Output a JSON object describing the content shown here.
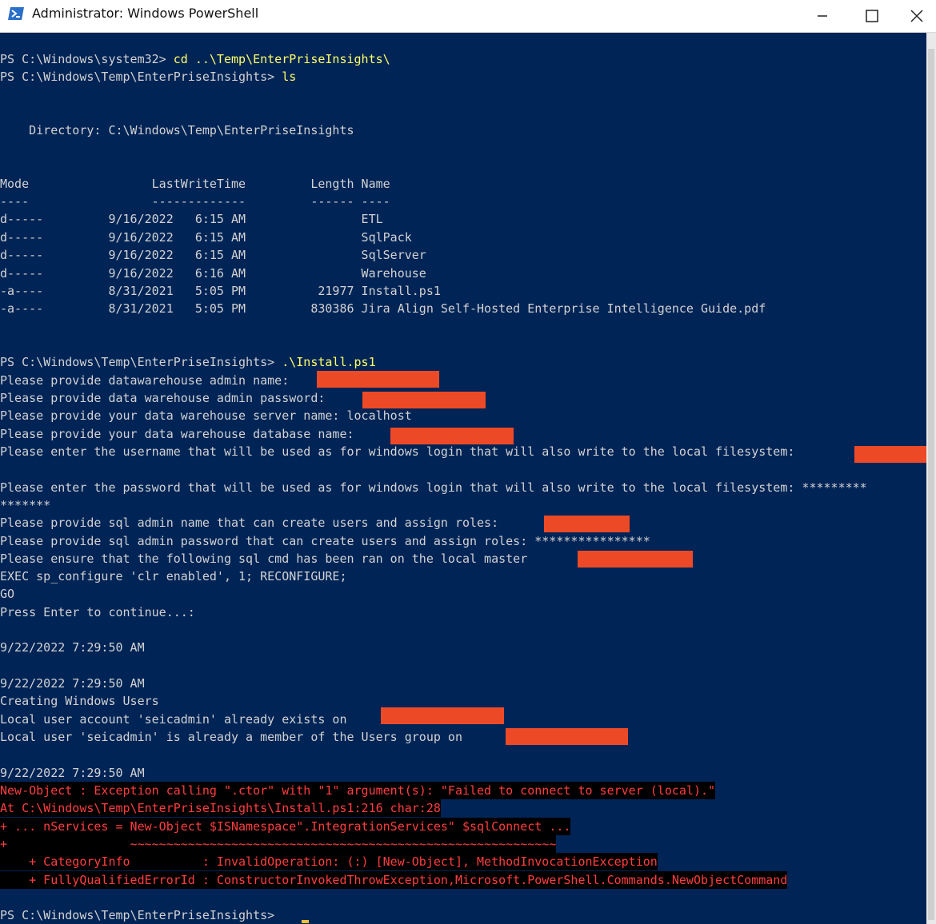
{
  "window": {
    "title": "Administrator: Windows PowerShell",
    "min_icon": "minimize-icon",
    "max_icon": "maximize-icon",
    "close_icon": "close-icon"
  },
  "colors": {
    "background": "#012456",
    "text": "#d2d2d2",
    "command": "#ffff66",
    "error": "#ff3d3d",
    "redaction": "#ec4a27"
  },
  "console": {
    "l1_prompt": "PS C:\\Windows\\system32> ",
    "l1_cmd": "cd ..\\Temp\\EnterPriseInsights\\",
    "l2_prompt": "PS C:\\Windows\\Temp\\EnterPriseInsights> ",
    "l2_cmd": "ls",
    "directory": "    Directory: C:\\Windows\\Temp\\EnterPriseInsights",
    "header": "Mode                 LastWriteTime         Length Name",
    "header_rule": "----                 -------------         ------ ----",
    "files": [
      "d-----         9/16/2022   6:15 AM                ETL",
      "d-----         9/16/2022   6:15 AM                SqlPack",
      "d-----         9/16/2022   6:15 AM                SqlServer",
      "d-----         9/16/2022   6:16 AM                Warehouse",
      "-a----         8/31/2021   5:05 PM          21977 Install.ps1",
      "-a----         8/31/2021   5:05 PM         830386 Jira Align Self-Hosted Enterprise Intelligence Guide.pdf"
    ],
    "l3_prompt": "PS C:\\Windows\\Temp\\EnterPriseInsights> ",
    "l3_cmd": ".\\Install.ps1",
    "q_admin_name": "Please provide datawarehouse admin name: ",
    "q_admin_pw": "Please provide data warehouse admin password: ",
    "q_server": "Please provide your data warehouse server name: localhost",
    "q_db": "Please provide your data warehouse database name: ",
    "q_win_user": "Please enter the username that will be used as for windows login that will also write to the local filesystem: ",
    "q_win_pw": "Please enter the password that will be used as for windows login that will also write to the local filesystem: *********",
    "q_win_pw_cont": "*******",
    "q_sql_admin": "Please provide sql admin name that can create users and assign roles: ",
    "q_sql_pw": "Please provide sql admin password that can create users and assign roles: ****************",
    "q_ensure": "Please ensure that the following sql cmd has been ran on the local master ",
    "exec_line": "EXEC sp_configure 'clr enabled', 1; RECONFIGURE;",
    "go_line": "GO",
    "press_enter": "Press Enter to continue...:",
    "ts1": "9/22/2022 7:29:50 AM",
    "ts2": "9/22/2022 7:29:50 AM",
    "creating": "Creating Windows Users",
    "local_exists": "Local user account 'seicadmin' already exists on ",
    "local_member": "Local user 'seicadmin' is already a member of the Users group on ",
    "ts3": "9/22/2022 7:29:50 AM",
    "err1": "New-Object : Exception calling \".ctor\" with \"1\" argument(s): \"Failed to connect to server (local).\"",
    "err2": "At C:\\Windows\\Temp\\EnterPriseInsights\\Install.ps1:216 char:28",
    "err3": "+ ... nServices = New-Object $ISNamespace\".IntegrationServices\" $sqlConnect ...",
    "err4": "+                 ~~~~~~~~~~~~~~~~~~~~~~~~~~~~~~~~~~~~~~~~~~~~~~~~~~~~~~~~~~~",
    "err5": "    + CategoryInfo          : InvalidOperation: (:) [New-Object], MethodInvocationException",
    "err6": "    + FullyQualifiedErrorId : ConstructorInvokedThrowException,Microsoft.PowerShell.Commands.NewObjectCommand",
    "final_prompt": "PS C:\\Windows\\Temp\\EnterPriseInsights> "
  }
}
